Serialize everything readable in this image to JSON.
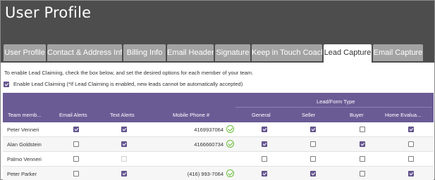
{
  "page": {
    "title": "User Profile"
  },
  "tabs": [
    {
      "label": "User Profile",
      "active": false
    },
    {
      "label": "Contact & Address Info",
      "active": false
    },
    {
      "label": "Billing Info",
      "active": false
    },
    {
      "label": "Email Header",
      "active": false
    },
    {
      "label": "Signature",
      "active": false
    },
    {
      "label": "Keep in Touch Coach",
      "active": false
    },
    {
      "label": "Lead Capture",
      "active": true
    },
    {
      "label": "Email Capture",
      "active": false
    }
  ],
  "lead_capture": {
    "instructions": "To enable Lead Claiming, check the box below, and set the desired options for each member of your team.",
    "enable_label": "Enable Lead Claiming (*If Lead Claiming is enabled, new leads cannot be automatically accepted)",
    "enable_checked": true
  },
  "table": {
    "group_header": "Lead/Form Type",
    "columns": {
      "member": "Team memb...",
      "email_alerts": "Email Alerts",
      "text_alerts": "Text Alerts",
      "mobile": "Mobile Phone #",
      "general": "General",
      "seller": "Seller",
      "buyer": "Buyer",
      "home_eval": "Home Evalua..."
    },
    "rows": [
      {
        "name": "Peter Venneri",
        "email": true,
        "text": true,
        "text_disabled": false,
        "phone": "4169937064",
        "verified": true,
        "general": true,
        "seller": true,
        "buyer": false,
        "home": true
      },
      {
        "name": "Alan Goldstein",
        "email": false,
        "text": true,
        "text_disabled": false,
        "phone": "4166660734",
        "verified": true,
        "general": true,
        "seller": false,
        "buyer": true,
        "home": false
      },
      {
        "name": "Palmo Venneri",
        "email": false,
        "text": false,
        "text_disabled": true,
        "phone": "",
        "verified": false,
        "general": false,
        "seller": false,
        "buyer": false,
        "home": false
      },
      {
        "name": "Peter Parker",
        "email": false,
        "text": true,
        "text_disabled": false,
        "phone": "(416) 993-7064",
        "verified": true,
        "general": true,
        "seller": true,
        "buyer": false,
        "home": true
      }
    ]
  },
  "colors": {
    "header_bg": "#4d4d4d",
    "table_header": "#6b5b95",
    "checkbox": "#6b5b95",
    "verified": "#6abf3a",
    "tab_inactive": "#a3a3a3"
  }
}
